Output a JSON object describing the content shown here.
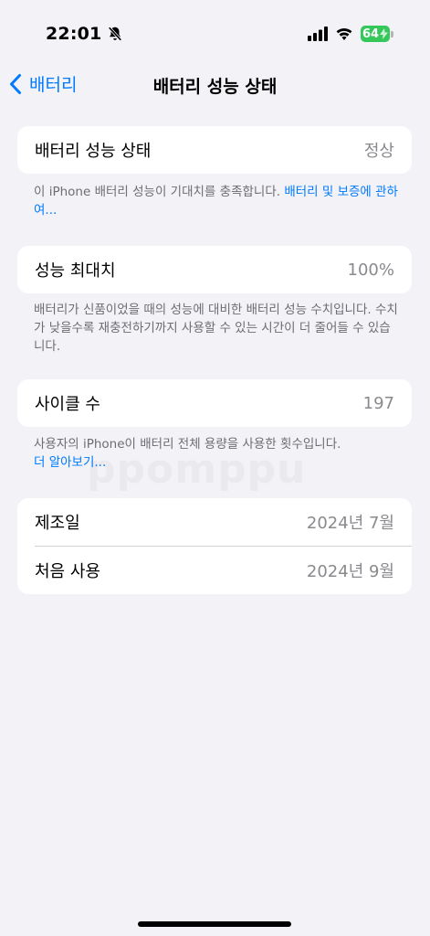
{
  "status_bar": {
    "time": "22:01",
    "battery_level": "64",
    "battery_color": "#34c759"
  },
  "nav": {
    "back_label": "배터리",
    "title": "배터리 성능 상태"
  },
  "sections": {
    "health": {
      "label": "배터리 성능 상태",
      "value": "정상",
      "footnote_text": "이 iPhone 배터리 성능이 기대치를 충족합니다. ",
      "footnote_link": "배터리 및 보증에 관하여..."
    },
    "max_capacity": {
      "label": "성능 최대치",
      "value": "100%",
      "footnote_text": "배터리가 신품이었을 때의 성능에 대비한 배터리 성능 수치입니다. 수치가 낮을수록 재충전하기까지 사용할 수 있는 시간이 더 줄어들 수 있습니다."
    },
    "cycle_count": {
      "label": "사이클 수",
      "value": "197",
      "footnote_text": "사용자의 iPhone이 배터리 전체 용량을 사용한 횟수입니다.",
      "footnote_link": "더 알아보기..."
    },
    "dates": {
      "manufacture_label": "제조일",
      "manufacture_value": "2024년 7월",
      "first_use_label": "처음 사용",
      "first_use_value": "2024년 9월"
    }
  },
  "watermark": "ppomppu"
}
